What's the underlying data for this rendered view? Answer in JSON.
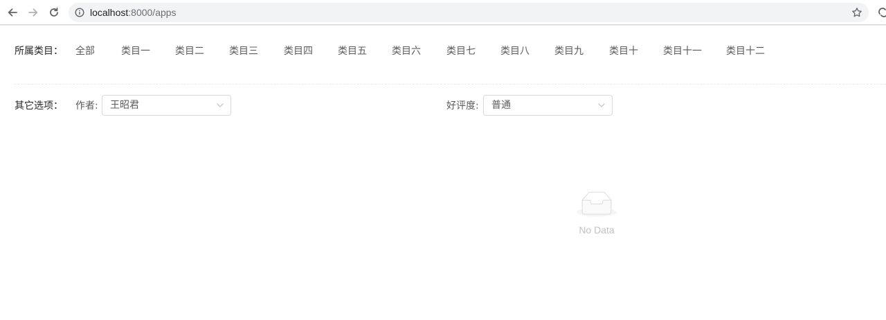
{
  "browser": {
    "url_host": "localhost",
    "url_path": ":8000/apps"
  },
  "filters": {
    "category": {
      "label": "所属类目：",
      "items": [
        "全部",
        "类目一",
        "类目二",
        "类目三",
        "类目四",
        "类目五",
        "类目六",
        "类目七",
        "类目八",
        "类目九",
        "类目十",
        "类目十一",
        "类目十二"
      ]
    },
    "other": {
      "label": "其它选项：",
      "author_label": "作者:",
      "author_value": "王昭君",
      "rating_label": "好评度:",
      "rating_value": "普通"
    }
  },
  "empty": {
    "text": "No Data"
  }
}
